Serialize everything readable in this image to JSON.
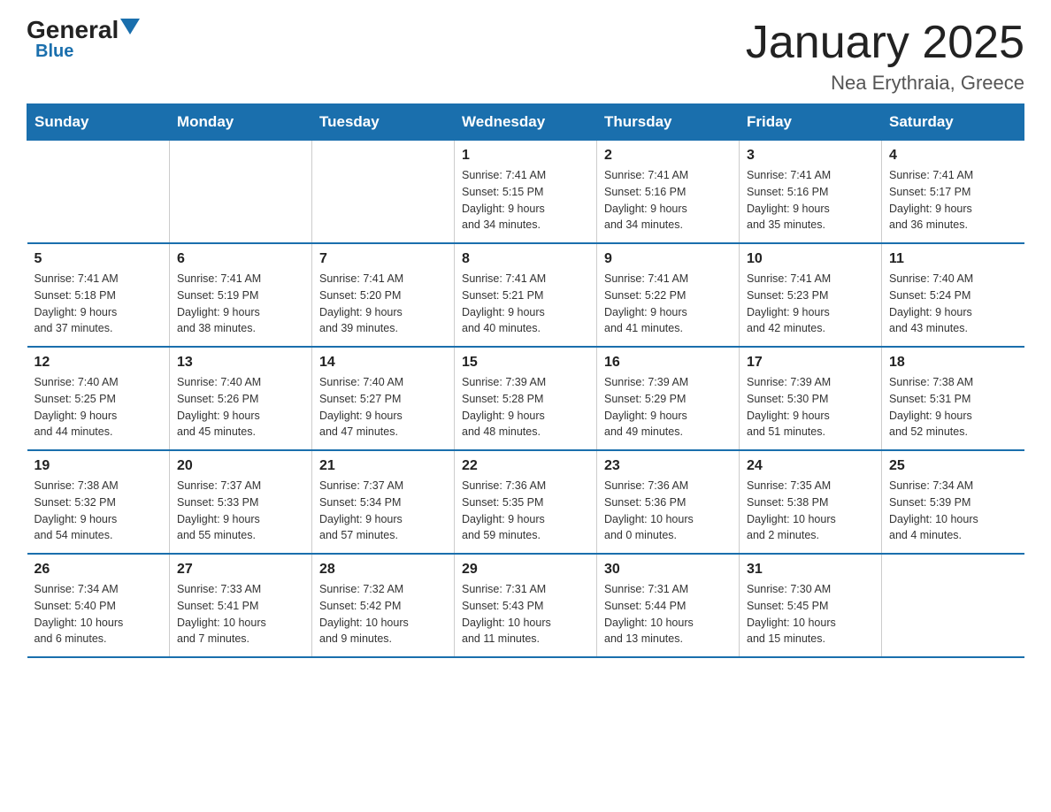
{
  "logo": {
    "general": "General",
    "blue": "Blue",
    "arrow": "▼"
  },
  "title": "January 2025",
  "location": "Nea Erythraia, Greece",
  "weekdays": [
    "Sunday",
    "Monday",
    "Tuesday",
    "Wednesday",
    "Thursday",
    "Friday",
    "Saturday"
  ],
  "weeks": [
    [
      {
        "day": "",
        "info": ""
      },
      {
        "day": "",
        "info": ""
      },
      {
        "day": "",
        "info": ""
      },
      {
        "day": "1",
        "info": "Sunrise: 7:41 AM\nSunset: 5:15 PM\nDaylight: 9 hours\nand 34 minutes."
      },
      {
        "day": "2",
        "info": "Sunrise: 7:41 AM\nSunset: 5:16 PM\nDaylight: 9 hours\nand 34 minutes."
      },
      {
        "day": "3",
        "info": "Sunrise: 7:41 AM\nSunset: 5:16 PM\nDaylight: 9 hours\nand 35 minutes."
      },
      {
        "day": "4",
        "info": "Sunrise: 7:41 AM\nSunset: 5:17 PM\nDaylight: 9 hours\nand 36 minutes."
      }
    ],
    [
      {
        "day": "5",
        "info": "Sunrise: 7:41 AM\nSunset: 5:18 PM\nDaylight: 9 hours\nand 37 minutes."
      },
      {
        "day": "6",
        "info": "Sunrise: 7:41 AM\nSunset: 5:19 PM\nDaylight: 9 hours\nand 38 minutes."
      },
      {
        "day": "7",
        "info": "Sunrise: 7:41 AM\nSunset: 5:20 PM\nDaylight: 9 hours\nand 39 minutes."
      },
      {
        "day": "8",
        "info": "Sunrise: 7:41 AM\nSunset: 5:21 PM\nDaylight: 9 hours\nand 40 minutes."
      },
      {
        "day": "9",
        "info": "Sunrise: 7:41 AM\nSunset: 5:22 PM\nDaylight: 9 hours\nand 41 minutes."
      },
      {
        "day": "10",
        "info": "Sunrise: 7:41 AM\nSunset: 5:23 PM\nDaylight: 9 hours\nand 42 minutes."
      },
      {
        "day": "11",
        "info": "Sunrise: 7:40 AM\nSunset: 5:24 PM\nDaylight: 9 hours\nand 43 minutes."
      }
    ],
    [
      {
        "day": "12",
        "info": "Sunrise: 7:40 AM\nSunset: 5:25 PM\nDaylight: 9 hours\nand 44 minutes."
      },
      {
        "day": "13",
        "info": "Sunrise: 7:40 AM\nSunset: 5:26 PM\nDaylight: 9 hours\nand 45 minutes."
      },
      {
        "day": "14",
        "info": "Sunrise: 7:40 AM\nSunset: 5:27 PM\nDaylight: 9 hours\nand 47 minutes."
      },
      {
        "day": "15",
        "info": "Sunrise: 7:39 AM\nSunset: 5:28 PM\nDaylight: 9 hours\nand 48 minutes."
      },
      {
        "day": "16",
        "info": "Sunrise: 7:39 AM\nSunset: 5:29 PM\nDaylight: 9 hours\nand 49 minutes."
      },
      {
        "day": "17",
        "info": "Sunrise: 7:39 AM\nSunset: 5:30 PM\nDaylight: 9 hours\nand 51 minutes."
      },
      {
        "day": "18",
        "info": "Sunrise: 7:38 AM\nSunset: 5:31 PM\nDaylight: 9 hours\nand 52 minutes."
      }
    ],
    [
      {
        "day": "19",
        "info": "Sunrise: 7:38 AM\nSunset: 5:32 PM\nDaylight: 9 hours\nand 54 minutes."
      },
      {
        "day": "20",
        "info": "Sunrise: 7:37 AM\nSunset: 5:33 PM\nDaylight: 9 hours\nand 55 minutes."
      },
      {
        "day": "21",
        "info": "Sunrise: 7:37 AM\nSunset: 5:34 PM\nDaylight: 9 hours\nand 57 minutes."
      },
      {
        "day": "22",
        "info": "Sunrise: 7:36 AM\nSunset: 5:35 PM\nDaylight: 9 hours\nand 59 minutes."
      },
      {
        "day": "23",
        "info": "Sunrise: 7:36 AM\nSunset: 5:36 PM\nDaylight: 10 hours\nand 0 minutes."
      },
      {
        "day": "24",
        "info": "Sunrise: 7:35 AM\nSunset: 5:38 PM\nDaylight: 10 hours\nand 2 minutes."
      },
      {
        "day": "25",
        "info": "Sunrise: 7:34 AM\nSunset: 5:39 PM\nDaylight: 10 hours\nand 4 minutes."
      }
    ],
    [
      {
        "day": "26",
        "info": "Sunrise: 7:34 AM\nSunset: 5:40 PM\nDaylight: 10 hours\nand 6 minutes."
      },
      {
        "day": "27",
        "info": "Sunrise: 7:33 AM\nSunset: 5:41 PM\nDaylight: 10 hours\nand 7 minutes."
      },
      {
        "day": "28",
        "info": "Sunrise: 7:32 AM\nSunset: 5:42 PM\nDaylight: 10 hours\nand 9 minutes."
      },
      {
        "day": "29",
        "info": "Sunrise: 7:31 AM\nSunset: 5:43 PM\nDaylight: 10 hours\nand 11 minutes."
      },
      {
        "day": "30",
        "info": "Sunrise: 7:31 AM\nSunset: 5:44 PM\nDaylight: 10 hours\nand 13 minutes."
      },
      {
        "day": "31",
        "info": "Sunrise: 7:30 AM\nSunset: 5:45 PM\nDaylight: 10 hours\nand 15 minutes."
      },
      {
        "day": "",
        "info": ""
      }
    ]
  ]
}
